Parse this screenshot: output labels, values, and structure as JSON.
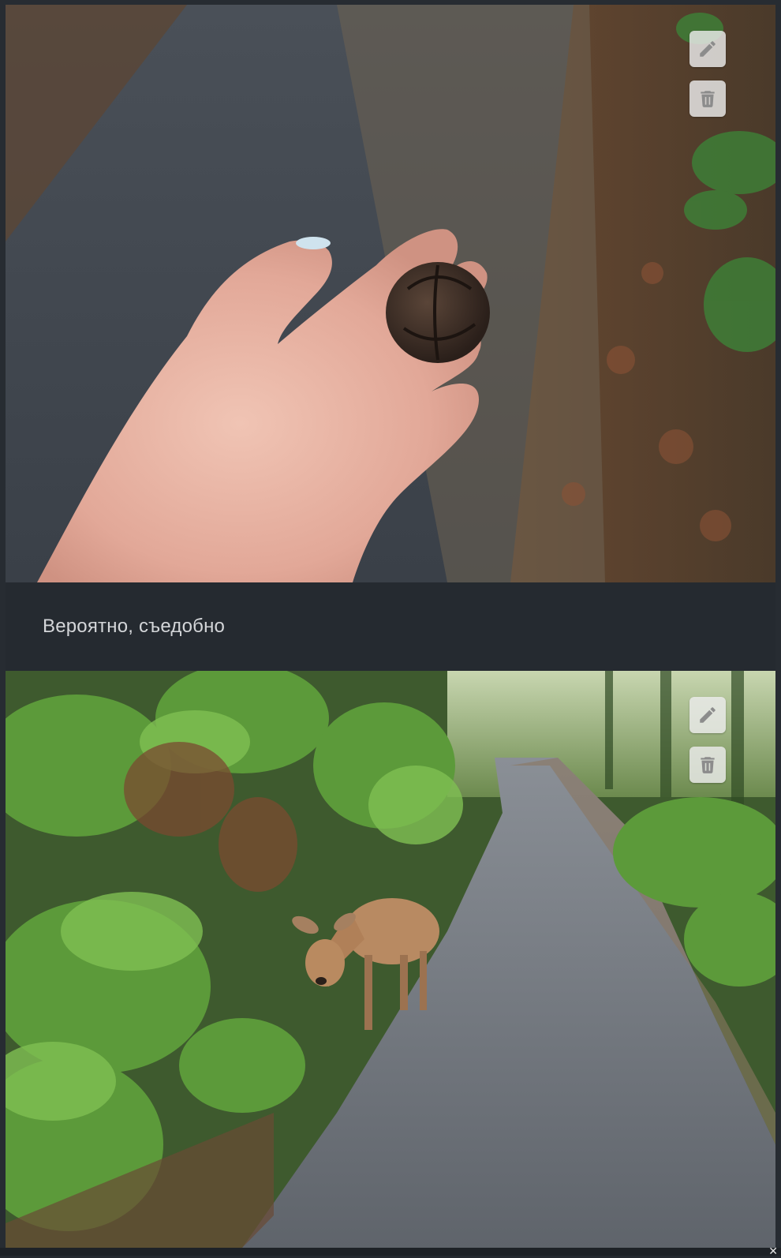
{
  "posts": [
    {
      "image_description_icon": "photo-hand-holding-nut-on-path",
      "edit_icon": "pencil-icon",
      "delete_icon": "trash-icon"
    },
    {
      "image_description_icon": "photo-deer-on-forest-road",
      "edit_icon": "pencil-icon",
      "delete_icon": "trash-icon"
    }
  ],
  "caption": {
    "text": "Вероятно, съедобно"
  },
  "colors": {
    "background": "#272c32",
    "caption_text": "#d4d6d9",
    "button_bg": "#ebebeb",
    "button_icon": "#8c8c8c"
  }
}
